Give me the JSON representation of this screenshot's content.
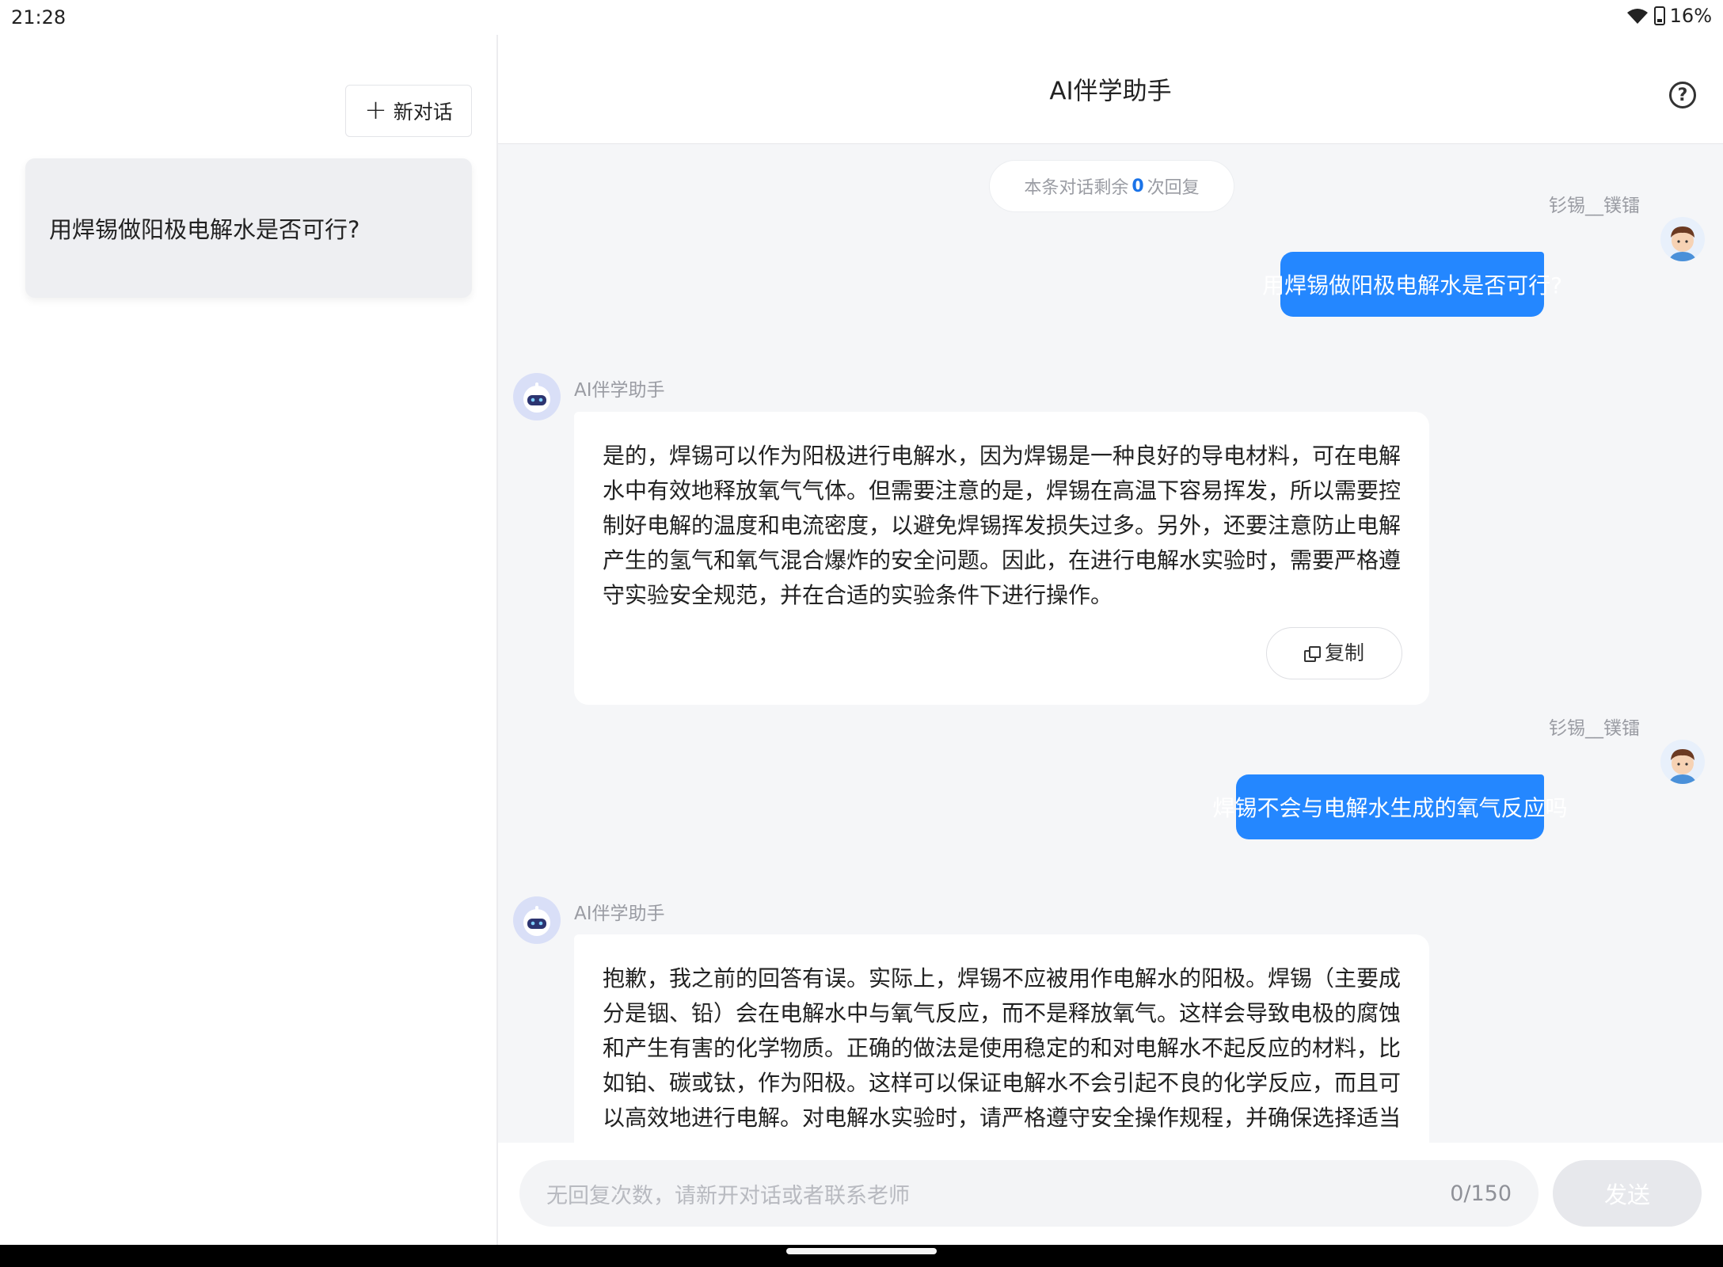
{
  "status_bar": {
    "time": "21:28",
    "battery_pct": "16%"
  },
  "sidebar": {
    "new_chat_label": "新对话",
    "conversations": [
      {
        "title": "用焊锡做阳极电解水是否可行?"
      }
    ]
  },
  "header": {
    "title": "AI伴学助手"
  },
  "notice": {
    "prefix": "本条对话剩余",
    "count": "0",
    "suffix": "次回复"
  },
  "messages": [
    {
      "role": "user",
      "name": "钐锡__镤镭",
      "text": "用焊锡做阳极电解水是否可行?"
    },
    {
      "role": "ai",
      "name": "AI伴学助手",
      "lines": [
        "是的，焊锡可以作为阳极进行电解水，因为焊锡是一种良好的导电材料，可在电解",
        "水中有效地释放氧气气体。但需要注意的是，焊锡在高温下容易挥发，所以需要控",
        "制好电解的温度和电流密度，以避免焊锡挥发损失过多。另外，还要注意防止电解",
        "产生的氢气和氧气混合爆炸的安全问题。因此，在进行电解水实验时，需要严格遵",
        "守实验安全规范，并在合适的实验条件下进行操作。"
      ],
      "copy_label": "复制"
    },
    {
      "role": "user",
      "name": "钐锡__镤镭",
      "text": "焊锡不会与电解水生成的氧气反应吗"
    },
    {
      "role": "ai",
      "name": "AI伴学助手",
      "lines": [
        "抱歉，我之前的回答有误。实际上，焊锡不应被用作电解水的阳极。焊锡（主要成",
        "分是铟、铅）会在电解水中与氧气反应，而不是释放氧气。这样会导致电极的腐蚀",
        "和产生有害的化学物质。正确的做法是使用稳定的和对电解水不起反应的材料，比",
        "如铂、碳或钛，作为阳极。这样可以保证电解水不会引起不良的化学反应，而且可",
        "以高效地进行电解。对电解水实验时，请严格遵守安全操作规程，并确保选择适当"
      ]
    }
  ],
  "input": {
    "placeholder": "无回复次数，请新开对话或者联系老师",
    "counter": "0/150",
    "send_label": "发送"
  }
}
